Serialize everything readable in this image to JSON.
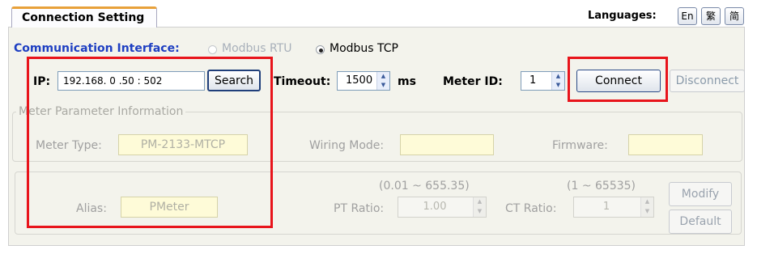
{
  "header": {
    "tab_title": "Connection Setting",
    "languages_label": "Languages:",
    "language_buttons": [
      "En",
      "繁",
      "简"
    ]
  },
  "interface": {
    "label": "Communication Interface:",
    "options": [
      {
        "label": "Modbus RTU",
        "selected": false,
        "enabled": false
      },
      {
        "label": "Modbus TCP",
        "selected": true,
        "enabled": true
      }
    ]
  },
  "connection": {
    "ip_label": "IP:",
    "ip_value": "192.168. 0 .50 : 502",
    "search_label": "Search",
    "timeout_label": "Timeout:",
    "timeout_value": "1500",
    "timeout_unit": "ms",
    "meter_id_label": "Meter ID:",
    "meter_id_value": "1",
    "connect_label": "Connect",
    "disconnect_label": "Disconnect"
  },
  "meter_info": {
    "group_title": "Meter Parameter Information",
    "meter_type_label": "Meter Type:",
    "meter_type_value": "PM-2133-MTCP",
    "wiring_mode_label": "Wiring Mode:",
    "wiring_mode_value": "",
    "firmware_label": "Firmware:",
    "firmware_value": ""
  },
  "params": {
    "alias_label": "Alias:",
    "alias_value": "PMeter",
    "pt_range": "(0.01 ~ 655.35)",
    "pt_label": "PT Ratio:",
    "pt_value": "1.00",
    "ct_range": "(1 ~ 65535)",
    "ct_label": "CT Ratio:",
    "ct_value": "1",
    "modify_label": "Modify",
    "default_label": "Default"
  },
  "colors": {
    "accent_blue": "#1e3fc2",
    "highlight_red": "#e8141b",
    "tab_orange": "#e8a13a",
    "disabled_field_yellow": "#fefbd8"
  }
}
